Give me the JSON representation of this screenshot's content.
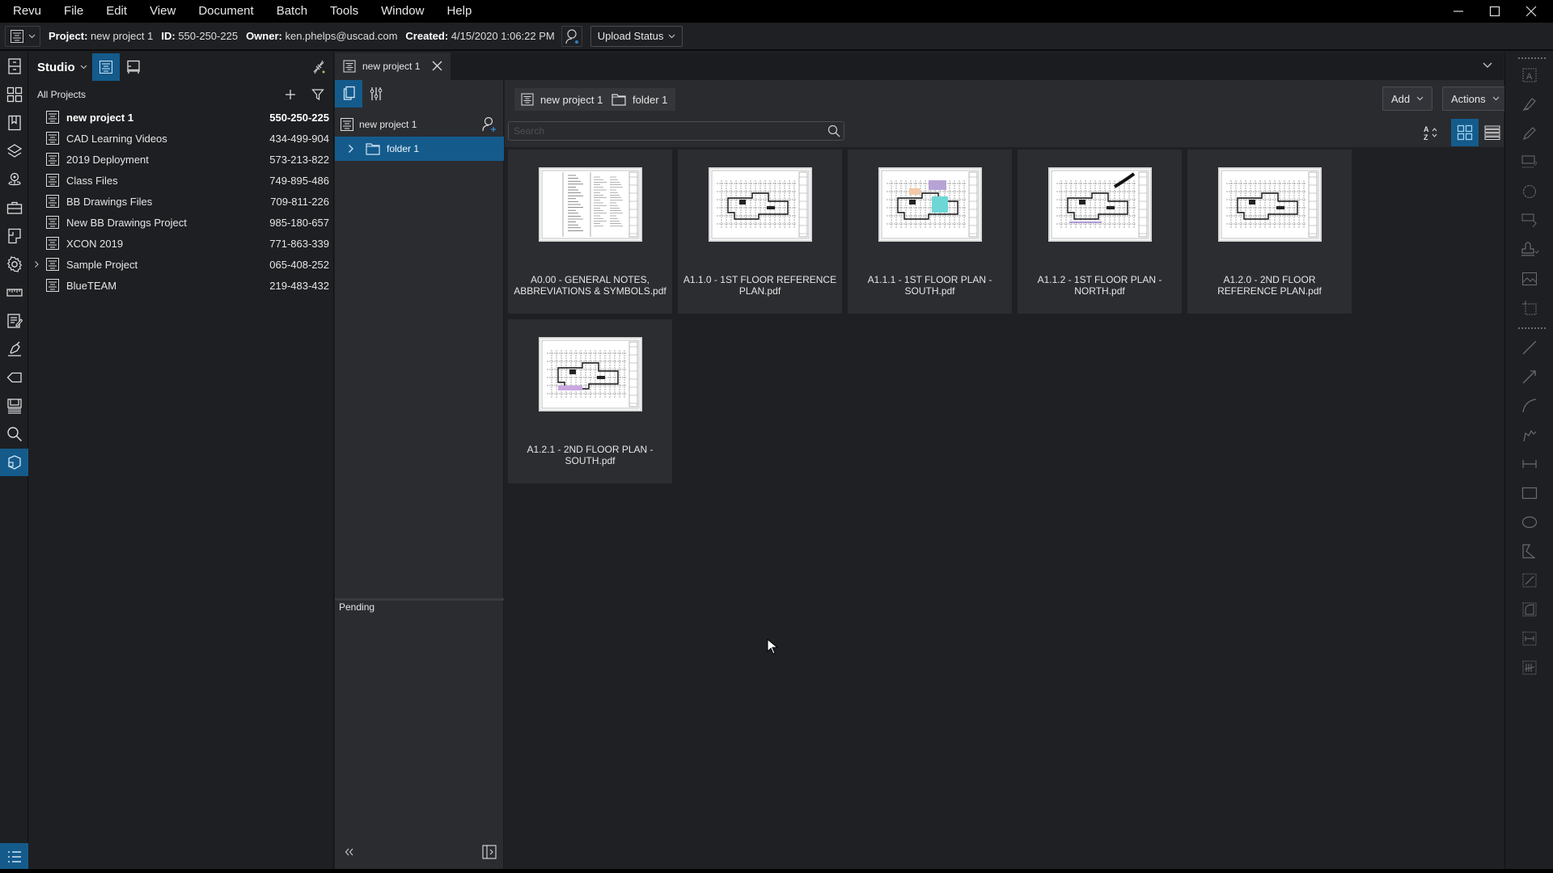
{
  "menubar": {
    "items": [
      "Revu",
      "File",
      "Edit",
      "View",
      "Document",
      "Batch",
      "Tools",
      "Window",
      "Help"
    ],
    "window_controls": [
      "minimize-icon",
      "maximize-icon",
      "close-icon"
    ]
  },
  "infobar": {
    "project_label": "Project:",
    "project_value": "new project 1",
    "id_label": "ID:",
    "id_value": "550-250-225",
    "owner_label": "Owner:",
    "owner_value": "ken.phelps@uscad.com",
    "created_label": "Created:",
    "created_value": "4/15/2020 1:06:22 PM",
    "upload_status_label": "Upload Status"
  },
  "rail": {
    "icons": [
      "file-cabinet-icon",
      "thumbnails-icon",
      "bookmarks-icon",
      "layers-icon",
      "places-icon",
      "toolbox-icon",
      "spaces-icon",
      "properties-icon",
      "measurements-icon",
      "markups-list-icon",
      "signatures-icon",
      "tags-icon",
      "sets-icon",
      "search-icon",
      "studio-icon"
    ],
    "active": "studio-icon",
    "bottom_icon": "markups-list-toggle-icon"
  },
  "studio": {
    "title": "Studio",
    "section_label": "All Projects",
    "projects": [
      {
        "name": "new project 1",
        "id": "550-250-225",
        "bold": true,
        "expandable": false
      },
      {
        "name": "CAD Learning Videos",
        "id": "434-499-904",
        "bold": false,
        "expandable": false
      },
      {
        "name": "2019 Deployment",
        "id": "573-213-822",
        "bold": false,
        "expandable": false
      },
      {
        "name": "Class Files",
        "id": "749-895-486",
        "bold": false,
        "expandable": false
      },
      {
        "name": "BB Drawings Files",
        "id": "709-811-226",
        "bold": false,
        "expandable": false
      },
      {
        "name": "New BB Drawings Project",
        "id": "985-180-657",
        "bold": false,
        "expandable": false
      },
      {
        "name": "XCON 2019",
        "id": "771-863-339",
        "bold": false,
        "expandable": false
      },
      {
        "name": "Sample Project",
        "id": "065-408-252",
        "bold": false,
        "expandable": true
      },
      {
        "name": "BlueTEAM",
        "id": "219-483-432",
        "bold": false,
        "expandable": false
      }
    ]
  },
  "tabs": {
    "open_tab": "new project 1"
  },
  "tree": {
    "root": "new project 1",
    "folder": "folder 1",
    "pending_label": "Pending"
  },
  "main": {
    "breadcrumb": [
      "new project 1",
      "folder 1"
    ],
    "add_label": "Add",
    "actions_label": "Actions",
    "search_placeholder": "Search",
    "view_mode": "grid",
    "files": [
      {
        "name": "A0.00 - GENERAL NOTES, ABBREVIATIONS & SYMBOLS.pdf",
        "thumb": "notes"
      },
      {
        "name": "A1.1.0 - 1ST FLOOR REFERENCE PLAN.pdf",
        "thumb": "plan"
      },
      {
        "name": "A1.1.1 - 1ST FLOOR PLAN - SOUTH.pdf",
        "thumb": "plan-color"
      },
      {
        "name": "A1.1.2 - 1ST FLOOR PLAN - NORTH.pdf",
        "thumb": "plan-curve"
      },
      {
        "name": "A1.2.0 - 2ND FLOOR REFERENCE PLAN.pdf",
        "thumb": "plan"
      },
      {
        "name": "A1.2.1 - 2ND FLOOR PLAN - SOUTH.pdf",
        "thumb": "plan-purple"
      }
    ]
  },
  "colors": {
    "accent": "#145b8c",
    "panel_bg": "#1e1f22",
    "tile_bg": "#2c2d31"
  }
}
